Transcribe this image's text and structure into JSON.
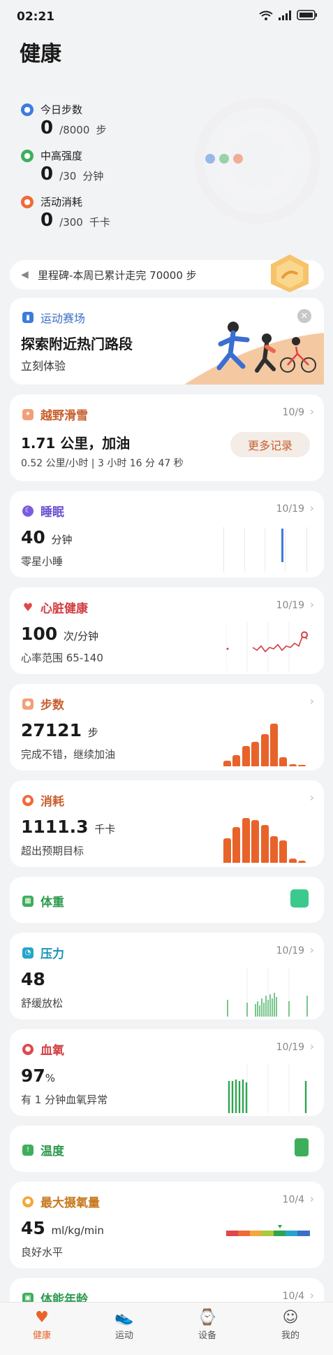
{
  "status": {
    "time": "02:21"
  },
  "page_title": "健康",
  "goals": [
    {
      "label": "今日步数",
      "value": "0",
      "target": "/8000",
      "unit": "步",
      "color": "#3b7ddd"
    },
    {
      "label": "中高强度",
      "value": "0",
      "target": "/30",
      "unit": "分钟",
      "color": "#3fae5b"
    },
    {
      "label": "活动消耗",
      "value": "0",
      "target": "/300",
      "unit": "千卡",
      "color": "#ef6a3a"
    }
  ],
  "milestone": {
    "text": "里程碑-本周已累计走完 70000 步"
  },
  "event": {
    "tag": "运动赛场",
    "title": "探索附近热门路段",
    "action": "立刻体验"
  },
  "ski": {
    "title": "越野滑雪",
    "date": "10/9",
    "value": "1.71 公里，加油",
    "detail": "0.52 公里/小时 | 3 小时 16 分 47 秒",
    "button": "更多记录"
  },
  "sleep": {
    "title": "睡眠",
    "date": "10/19",
    "value": "40",
    "unit": "分钟",
    "detail": "零星小睡"
  },
  "heart": {
    "title": "心脏健康",
    "date": "10/19",
    "value": "100",
    "unit": "次/分钟",
    "detail": "心率范围 65-140"
  },
  "steps": {
    "title": "步数",
    "date": "",
    "value": "27121",
    "unit": "步",
    "detail": "完成不错，继续加油",
    "bars": [
      0.12,
      0.25,
      0.45,
      0.55,
      0.72,
      0.95,
      0.2,
      0.05,
      0.03
    ]
  },
  "calories": {
    "title": "消耗",
    "date": "",
    "value": "1111.3",
    "unit": "千卡",
    "detail": "超出预期目标",
    "bars": [
      0.55,
      0.8,
      1.0,
      0.95,
      0.85,
      0.6,
      0.5,
      0.1,
      0.05
    ]
  },
  "weight": {
    "title": "体重"
  },
  "stress": {
    "title": "压力",
    "date": "10/19",
    "value": "48",
    "detail": "舒缓放松"
  },
  "spo2": {
    "title": "血氧",
    "date": "10/19",
    "value": "97",
    "unit": "%",
    "detail": "有 1 分钟血氧异常"
  },
  "temp": {
    "title": "温度"
  },
  "vo2": {
    "title": "最大摄氧量",
    "date": "10/4",
    "value": "45",
    "unit": "ml/kg/min",
    "detail": "良好水平"
  },
  "fitage": {
    "title": "体能年龄",
    "date": "10/4"
  },
  "tabs": [
    {
      "label": "健康"
    },
    {
      "label": "运动"
    },
    {
      "label": "设备"
    },
    {
      "label": "我的"
    }
  ],
  "colors": {
    "accent": "#e8632a",
    "bg": "#f2f3f5"
  }
}
